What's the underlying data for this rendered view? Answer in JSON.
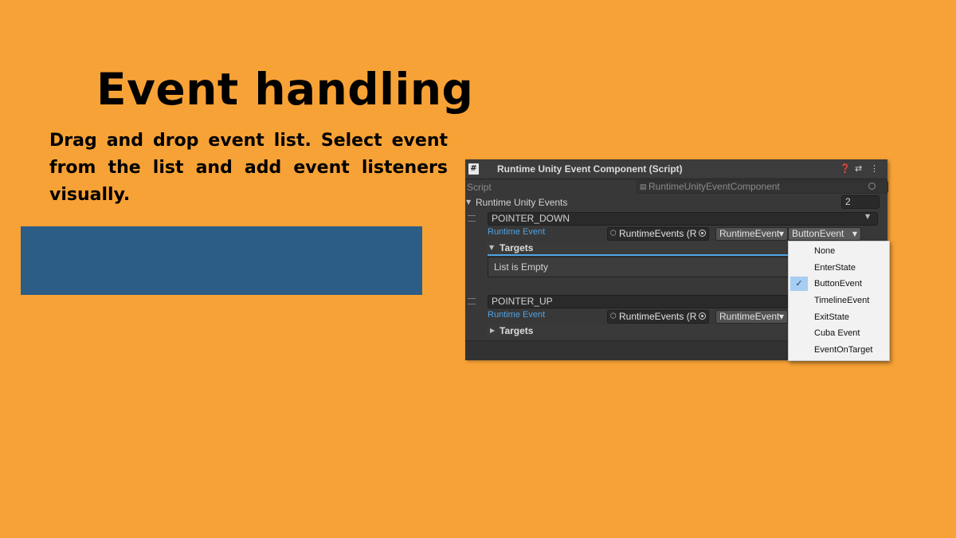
{
  "slide": {
    "title": "Event handling",
    "description": "Drag and drop event list. Select event from the list and add event listeners visually."
  },
  "inspector": {
    "header": {
      "title": "Runtime Unity Event Component (Script)",
      "icons": [
        "script-icon",
        "help-icon",
        "preset-icon",
        "more-icon"
      ]
    },
    "script_row": {
      "label": "Script",
      "value": "RuntimeUnityEventComponent"
    },
    "events_list": {
      "label": "Runtime Unity Events",
      "count": "2",
      "elements": [
        {
          "name": "POINTER_DOWN",
          "runtime_event_label": "Runtime Event",
          "object_field": "RuntimeEvents (R",
          "type_dropdown": "RuntimeEvent",
          "event_dropdown": "ButtonEvent",
          "targets_label": "Targets",
          "targets_expanded": true,
          "empty_text": "List is Empty"
        },
        {
          "name": "POINTER_UP",
          "runtime_event_label": "Runtime Event",
          "object_field": "RuntimeEvents (R",
          "type_dropdown": "RuntimeEvent",
          "targets_label": "Targets",
          "targets_expanded": false
        }
      ]
    }
  },
  "dropdown_menu": {
    "items": [
      "None",
      "EnterState",
      "ButtonEvent",
      "TimelineEvent",
      "ExitState",
      "Cuba Event",
      "EventOnTarget"
    ],
    "selected": "ButtonEvent"
  },
  "colors": {
    "background": "#F7A236",
    "inspector_bg": "#383838",
    "selection_blue": "#2C5D87",
    "runtime_label": "#4FA3E3",
    "menu_highlight": "#A6CDF2"
  }
}
